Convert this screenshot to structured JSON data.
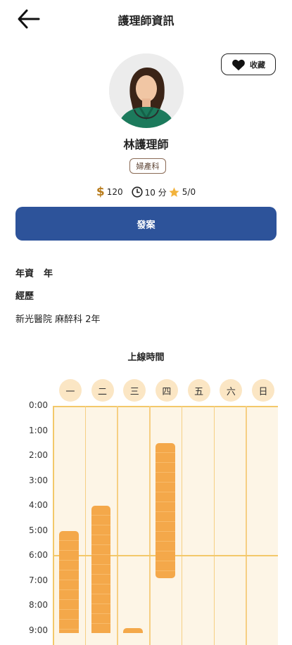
{
  "header": {
    "title": "護理師資訊",
    "back_icon": "arrow-left-icon"
  },
  "favorite": {
    "label": "收藏",
    "icon": "heart-icon"
  },
  "profile": {
    "name": "林護理師",
    "department": "婦產科",
    "price": "120",
    "price_icon": "dollar-icon",
    "duration": "10 分",
    "duration_icon": "clock-icon",
    "rating": "5/0",
    "rating_icon": "star-icon"
  },
  "cta": {
    "label": "發案",
    "color": "#2d539a"
  },
  "info": {
    "experience_label": "年資",
    "experience_value": "年",
    "history_label": "經歷",
    "history_text": "新光醫院 麻醉科 2年"
  },
  "schedule": {
    "title": "上線時間",
    "days": [
      "一",
      "二",
      "三",
      "四",
      "五",
      "六",
      "日"
    ],
    "hours": [
      "0:00",
      "1:00",
      "2:00",
      "3:00",
      "4:00",
      "5:00",
      "6:00",
      "7:00",
      "8:00",
      "9:00"
    ],
    "accent": "#f4a84a",
    "online_blocks": [
      {
        "day": "一",
        "start": 5.0,
        "end": 9.0
      },
      {
        "day": "二",
        "start": 4.0,
        "end": 9.0
      },
      {
        "day": "三",
        "start": 8.9,
        "end": 9.0
      },
      {
        "day": "四",
        "start": 1.5,
        "end": 6.9
      }
    ]
  }
}
